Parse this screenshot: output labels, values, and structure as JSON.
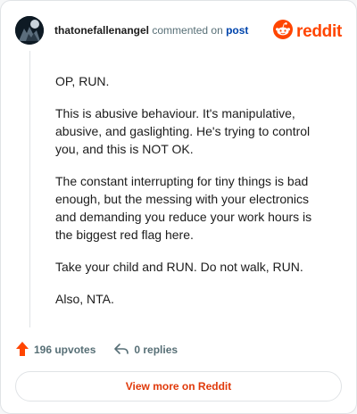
{
  "header": {
    "username": "thatonefallenangel",
    "action": "commented on",
    "post_link": "post",
    "logo_text": "reddit"
  },
  "comment": {
    "paragraphs": [
      "OP, RUN.",
      "This is abusive behaviour. It's manipulative, abusive, and gaslighting. He's trying to control you, and this is NOT OK.",
      "The constant interrupting for tiny things is bad enough, but the messing with your electronics and demanding you reduce your work hours is the biggest red flag here.",
      "Take your child and RUN. Do not walk, RUN.",
      "Also, NTA."
    ]
  },
  "actions": {
    "upvotes": "196 upvotes",
    "replies": "0 replies"
  },
  "cta": {
    "label": "View more on Reddit"
  },
  "colors": {
    "brand": "#ff4500",
    "link": "#0045ac",
    "muted": "#576f76",
    "cta": "#e0390a"
  },
  "icons": [
    "avatar",
    "reddit-snoo-icon",
    "upvote-arrow-icon",
    "reply-icon"
  ]
}
